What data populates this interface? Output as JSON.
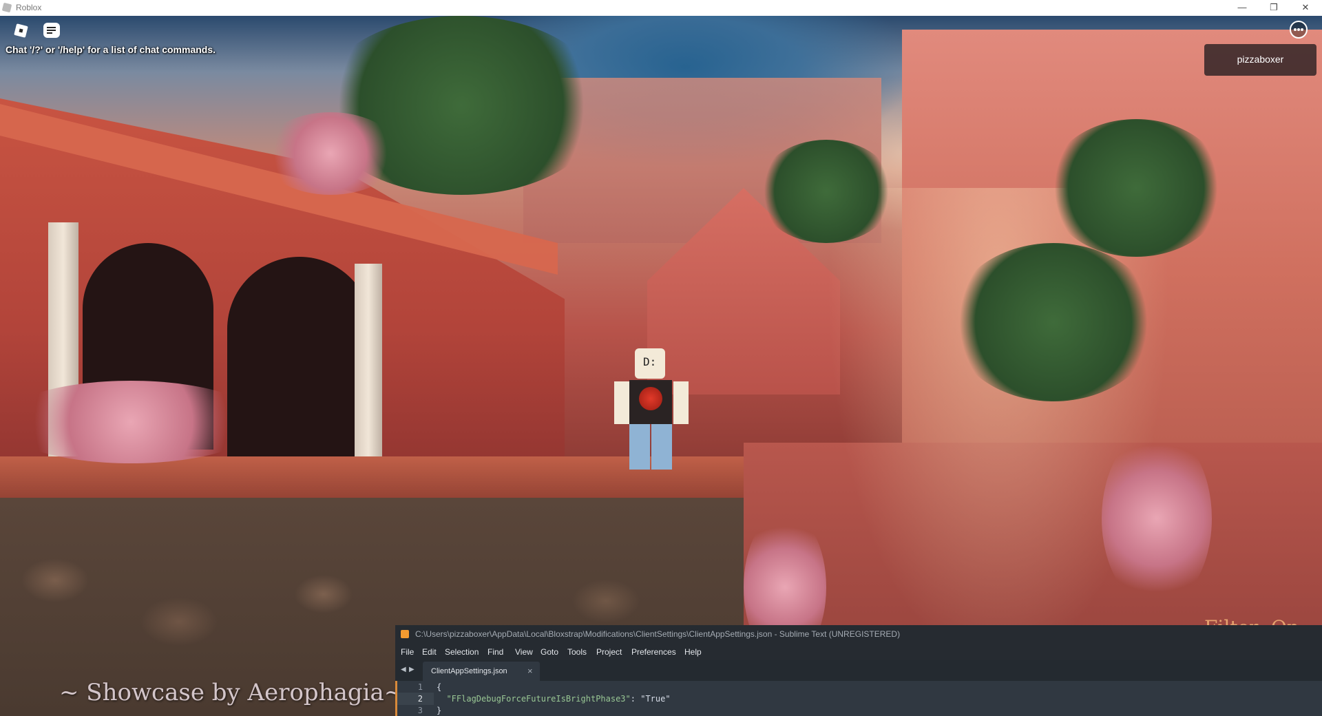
{
  "window": {
    "title": "Roblox",
    "minimize_glyph": "—",
    "maximize_glyph": "❐",
    "close_glyph": "✕"
  },
  "game": {
    "chat_hint": "Chat '/?' or '/help' for a list of chat commands.",
    "player_name": "pizzaboxer",
    "avatar_face": "D:",
    "showcase_text": "~ Showcase by Aerophagia~",
    "filter_text": "Filter: On",
    "icons": [
      "roblox-menu-icon",
      "chat-icon",
      "more-options-icon"
    ]
  },
  "sublime": {
    "title": "C:\\Users\\pizzaboxer\\AppData\\Local\\Bloxstrap\\Modifications\\ClientSettings\\ClientAppSettings.json - Sublime Text (UNREGISTERED)",
    "menu": [
      "File",
      "Edit",
      "Selection",
      "Find",
      "View",
      "Goto",
      "Tools",
      "Project",
      "Preferences",
      "Help"
    ],
    "nav_back": "◀",
    "nav_forward": "▶",
    "tab": {
      "label": "ClientAppSettings.json",
      "close": "×"
    },
    "lines": [
      {
        "num": "1",
        "text": "{"
      },
      {
        "num": "2",
        "key": "  \"FFlagDebugForceFutureIsBrightPhase3\"",
        "sep": ": ",
        "value": "\"True\""
      },
      {
        "num": "3",
        "text": "}"
      }
    ],
    "colors": {
      "accent": "#f49b30",
      "background": "#303841",
      "string": "#99c794"
    }
  }
}
